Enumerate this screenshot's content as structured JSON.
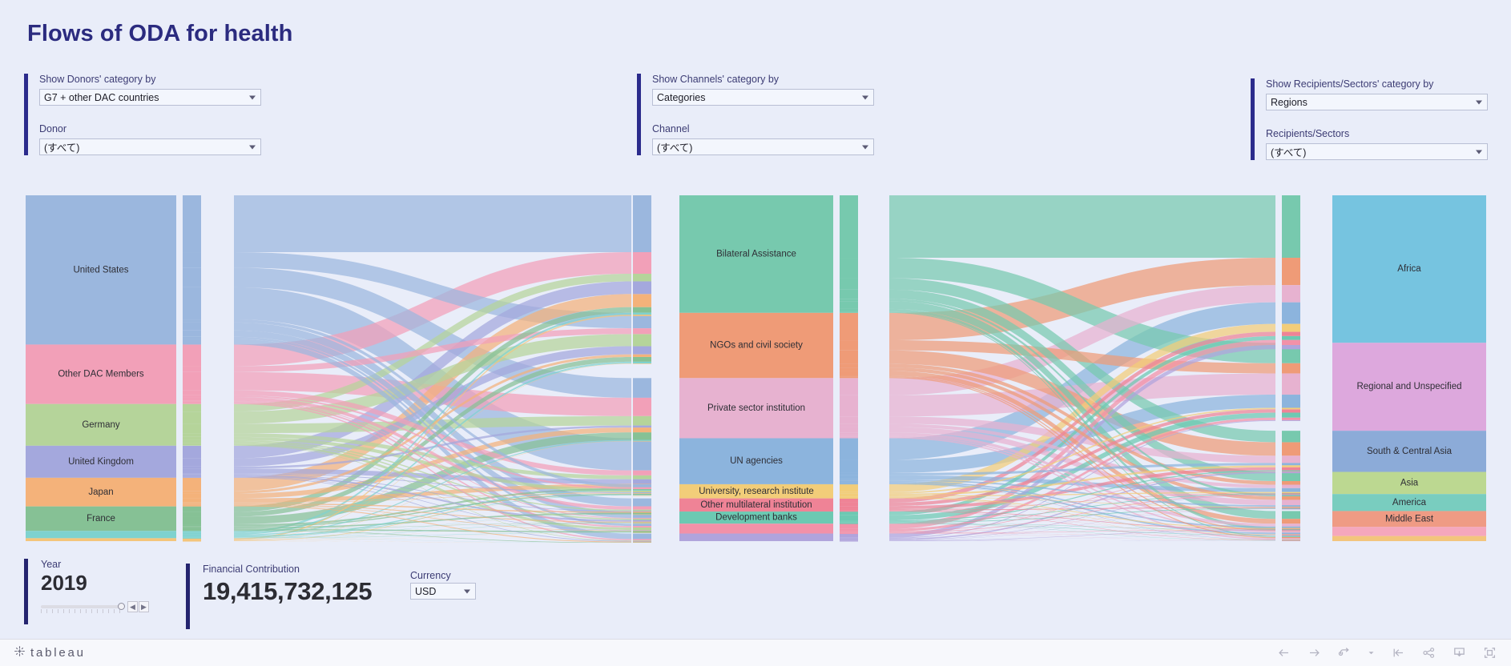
{
  "page": {
    "title": "Flows of ODA for health",
    "background": "#e9edf9",
    "accent": "#2b2b8c"
  },
  "filters": {
    "donors": {
      "category_label": "Show Donors' category by",
      "category_value": "G7 + other DAC countries",
      "item_label": "Donor",
      "item_value": "(すべて)"
    },
    "channels": {
      "category_label": "Show Channels' category by",
      "category_value": "Categories",
      "item_label": "Channel",
      "item_value": "(すべて)"
    },
    "recipients": {
      "category_label": "Show Recipients/Sectors' category by",
      "category_value": "Regions",
      "item_label": "Recipients/Sectors",
      "item_value": "(すべて)"
    }
  },
  "stats": {
    "year_label": "Year",
    "year_value": "2019",
    "contribution_label": "Financial Contribution",
    "contribution_value": "19,415,732,125",
    "currency_label": "Currency",
    "currency_value": "USD"
  },
  "footer": {
    "logo_text": "tableau",
    "icons": [
      "back-arrow-icon",
      "forward-arrow-icon",
      "revert-icon",
      "chevron-down-icon",
      "reset-icon",
      "share-icon",
      "download-icon",
      "fullscreen-icon"
    ]
  },
  "chart_data": {
    "type": "sankey",
    "title": "Flows of ODA for health",
    "value_total": 19415732125,
    "currency": "USD",
    "year": 2019,
    "stages": [
      "Donors",
      "Channels",
      "Recipients/Sectors"
    ],
    "nodes": {
      "donors": [
        {
          "label": "United States",
          "value": 6150,
          "color": "#9bb7de"
        },
        {
          "label": "Other DAC Members",
          "value": 2450,
          "color": "#f2a0b8"
        },
        {
          "label": "Germany",
          "value": 1720,
          "color": "#b5d49a"
        },
        {
          "label": "United Kingdom",
          "value": 1320,
          "color": "#a4a8dd"
        },
        {
          "label": "Japan",
          "value": 1180,
          "color": "#f4b27a"
        },
        {
          "label": "France",
          "value": 1010,
          "color": "#86c195"
        },
        {
          "label": "",
          "value": 300,
          "color": "#7ed2cf"
        },
        {
          "label": "",
          "value": 120,
          "color": "#f4c57a"
        }
      ],
      "channels": [
        {
          "label": "Bilateral Assistance",
          "value": 4650,
          "color": "#77c9ae"
        },
        {
          "label": "NGOs and civil society",
          "value": 2580,
          "color": "#ef9b77"
        },
        {
          "label": "Private sector institution",
          "value": 2380,
          "color": "#e7b2d0"
        },
        {
          "label": "UN agencies",
          "value": 1820,
          "color": "#8cb4dd"
        },
        {
          "label": "University, research institute",
          "value": 560,
          "color": "#f2cd79"
        },
        {
          "label": "Other multilateral institution",
          "value": 520,
          "color": "#ef8396"
        },
        {
          "label": "Development banks",
          "value": 480,
          "color": "#6cc9b2"
        },
        {
          "label": "",
          "value": 390,
          "color": "#f291a8"
        },
        {
          "label": "",
          "value": 300,
          "color": "#b0a4dc"
        }
      ],
      "recipients": [
        {
          "label": "Africa",
          "value": 5200,
          "color": "#76c4e0"
        },
        {
          "label": "Regional and Unspecified",
          "value": 3100,
          "color": "#dda8dd"
        },
        {
          "label": "South & Central Asia",
          "value": 1450,
          "color": "#8cabd8"
        },
        {
          "label": "Asia",
          "value": 780,
          "color": "#bcd891"
        },
        {
          "label": "America",
          "value": 600,
          "color": "#79cdbf"
        },
        {
          "label": "Middle East",
          "value": 560,
          "color": "#ef9b84"
        },
        {
          "label": "",
          "value": 320,
          "color": "#f5a7bd"
        },
        {
          "label": "",
          "value": 180,
          "color": "#f3c57d"
        }
      ]
    },
    "axis_labels": [],
    "legend": "none",
    "grid": false
  }
}
